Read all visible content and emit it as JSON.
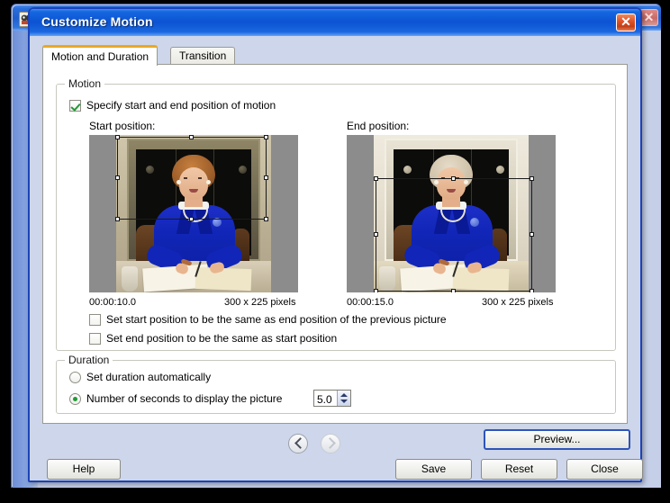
{
  "background_window": {
    "close_label": "✕",
    "icon": "app-icon"
  },
  "dialog": {
    "title": "Customize Motion",
    "close_label": "✕",
    "icon": "app-icon"
  },
  "tabs": [
    {
      "label": "Motion and Duration",
      "active": true
    },
    {
      "label": "Transition",
      "active": false
    }
  ],
  "motion": {
    "group_title": "Motion",
    "specify_checkbox": {
      "label": "Specify start and end position of motion",
      "checked": true
    },
    "start_label": "Start position:",
    "end_label": "End position:",
    "start": {
      "time": "00:00:10.0",
      "size": "300 x 225 pixels"
    },
    "end": {
      "time": "00:00:15.0",
      "size": "300 x 225 pixels"
    },
    "checkbox_start_same": {
      "label": "Set start position to be the same as end position of the previous picture",
      "checked": false
    },
    "checkbox_end_same": {
      "label": "Set end position to be the same as start position",
      "checked": false
    }
  },
  "duration": {
    "group_title": "Duration",
    "auto_radio": {
      "label": "Set duration automatically",
      "selected": false
    },
    "seconds_radio": {
      "label": "Number of seconds to display the picture",
      "selected": true
    },
    "seconds_value": "5.0"
  },
  "navigation": {
    "previous": "‹",
    "next": "›"
  },
  "buttons": {
    "help": "Help",
    "preview": "Preview...",
    "save": "Save",
    "reset": "Reset",
    "close": "Close"
  },
  "colors": {
    "title_blue": "#0b53d2",
    "dialog_face": "#cdd6ea",
    "tab_active_accent": "#e9a824",
    "check_green": "#1f9b36",
    "close_red": "#c33f17",
    "default_btn_border": "#2e55b8"
  }
}
